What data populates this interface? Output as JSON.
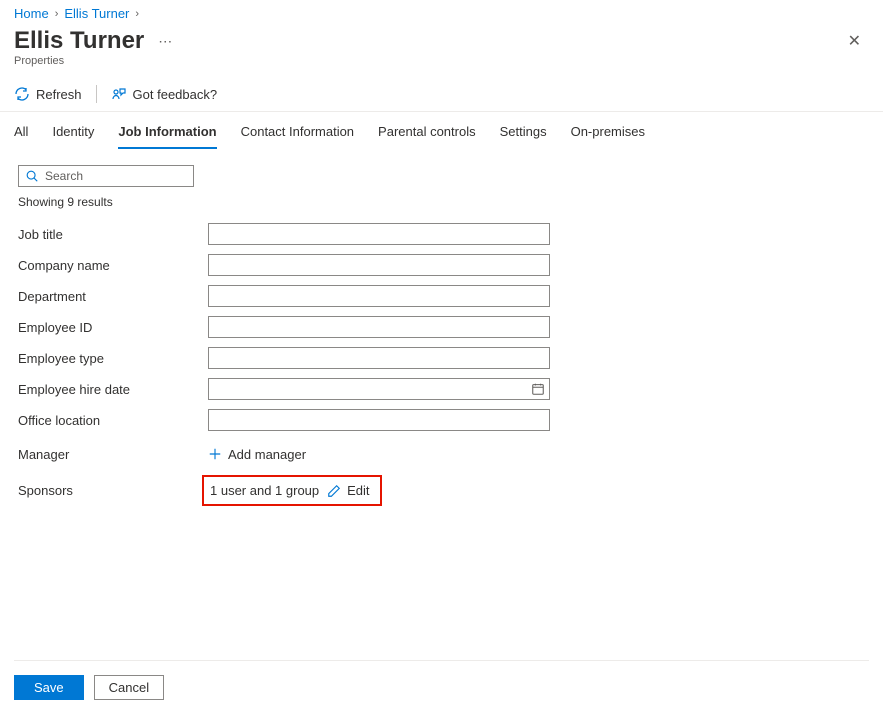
{
  "breadcrumb": {
    "home": "Home",
    "user": "Ellis Turner"
  },
  "header": {
    "title": "Ellis Turner",
    "subtitle": "Properties"
  },
  "toolbar": {
    "refresh": "Refresh",
    "feedback": "Got feedback?"
  },
  "tabs": {
    "all": "All",
    "identity": "Identity",
    "job": "Job Information",
    "contact": "Contact Information",
    "parental": "Parental controls",
    "settings": "Settings",
    "onprem": "On-premises"
  },
  "search": {
    "placeholder": "Search",
    "results": "Showing 9 results"
  },
  "fields": {
    "job_title": {
      "label": "Job title",
      "value": ""
    },
    "company_name": {
      "label": "Company name",
      "value": ""
    },
    "department": {
      "label": "Department",
      "value": ""
    },
    "employee_id": {
      "label": "Employee ID",
      "value": ""
    },
    "employee_type": {
      "label": "Employee type",
      "value": ""
    },
    "hire_date": {
      "label": "Employee hire date",
      "value": ""
    },
    "office": {
      "label": "Office location",
      "value": ""
    },
    "manager": {
      "label": "Manager",
      "action": "Add manager"
    },
    "sponsors": {
      "label": "Sponsors",
      "value": "1 user and 1 group",
      "action": "Edit"
    }
  },
  "footer": {
    "save": "Save",
    "cancel": "Cancel"
  }
}
